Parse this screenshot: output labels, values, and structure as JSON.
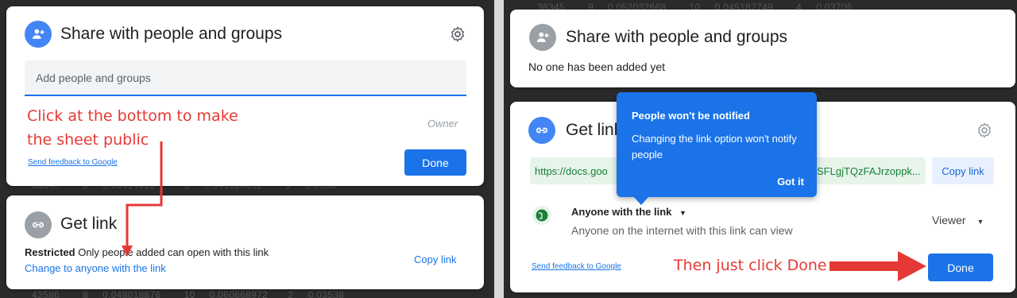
{
  "left": {
    "share_card": {
      "title": "Share with people and groups",
      "input_placeholder": "Add people and groups",
      "role_label": "Owner",
      "feedback_link": "Send feedback to Google",
      "done_button": "Done"
    },
    "annotation": [
      "Click at the bottom to make",
      "the sheet public"
    ],
    "link_card": {
      "title": "Get link",
      "access_level": "Restricted",
      "access_description": "Only people added can open with this link",
      "change_link": "Change to anyone with the link",
      "copy_link": "Copy link"
    },
    "background_rows": {
      "row_a": "36345        9     0.052032668        10     0.045182749        4     0.03706",
      "row_b": "36348        9     0.00014628          0     0.041528692        1     0.0353",
      "row_c": "43586        8     0.048018876        10     0.060668972       2     0.03538"
    }
  },
  "right": {
    "share_card": {
      "title": "Share with people and groups",
      "subtitle": "No one has been added yet"
    },
    "link_card": {
      "title": "Get link",
      "url_start": "https://docs.goo",
      "url_end": "SFLgjTQzFAJrzoppk...",
      "copy_link": "Copy link",
      "access_level": "Anyone with the link",
      "access_description": "Anyone on the internet with this link can view",
      "role": "Viewer",
      "feedback_link": "Send feedback to Google",
      "done_button": "Done"
    },
    "tooltip": {
      "title": "People won't be notified",
      "body": "Changing the link option won't notify people",
      "action": "Got it"
    },
    "annotation": "Then just click Done"
  },
  "colors": {
    "primary_blue": "#1a73e8",
    "annotation_red": "#e53935"
  }
}
